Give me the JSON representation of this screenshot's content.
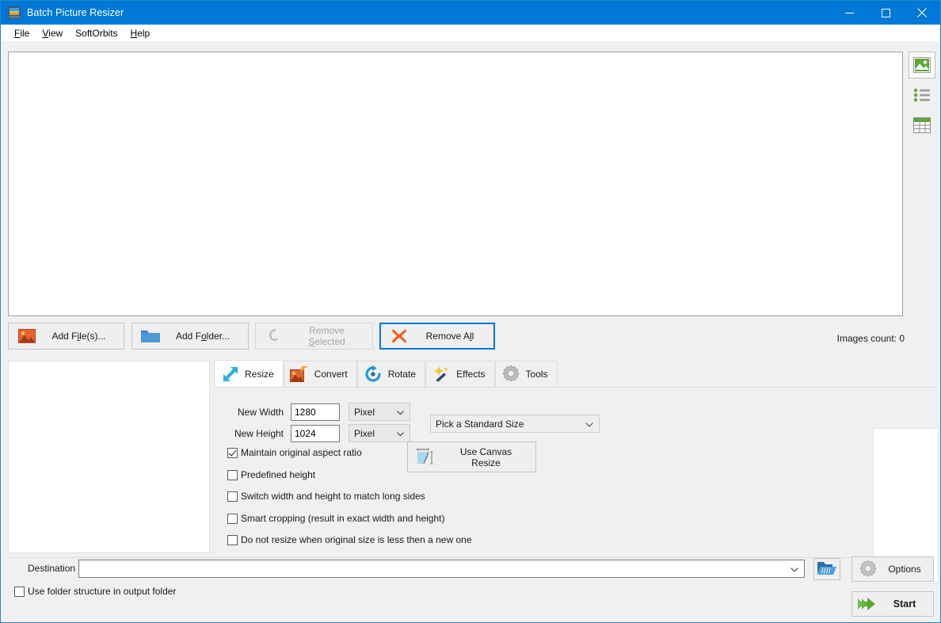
{
  "window": {
    "title": "Batch Picture Resizer",
    "icon": "app-picture-icon",
    "minimize": "minimize-icon",
    "maximize": "maximize-icon",
    "close": "close-icon"
  },
  "menubar": {
    "items": [
      {
        "label": "File",
        "accel": "F"
      },
      {
        "label": "View",
        "accel": "V"
      },
      {
        "label": "SoftOrbits",
        "accel": ""
      },
      {
        "label": "Help",
        "accel": "H"
      }
    ]
  },
  "viewmodes": [
    {
      "name": "thumbnails-view",
      "selected": true
    },
    {
      "name": "list-view",
      "selected": false
    },
    {
      "name": "details-view",
      "selected": false
    }
  ],
  "toolbar": {
    "add_files": "Add File(s)...",
    "add_folder": "Add Folder...",
    "remove_selected": "Remove Selected",
    "remove_all": "Remove All",
    "images_count": "Images count: 0"
  },
  "tabs": [
    {
      "label": "Resize",
      "icon": "resize-arrow-icon",
      "active": true
    },
    {
      "label": "Convert",
      "icon": "convert-image-icon",
      "active": false
    },
    {
      "label": "Rotate",
      "icon": "rotate-icon",
      "active": false
    },
    {
      "label": "Effects",
      "icon": "magic-wand-icon",
      "active": false
    },
    {
      "label": "Tools",
      "icon": "gear-icon",
      "active": false
    }
  ],
  "resize": {
    "width_label": "New Width",
    "width_value": "1280",
    "width_unit": "Pixel",
    "height_label": "New Height",
    "height_value": "1024",
    "height_unit": "Pixel",
    "standard_size": "Pick a Standard Size",
    "canvas_button": "Use Canvas Resize",
    "checkboxes": [
      {
        "label": "Maintain original aspect ratio",
        "checked": true
      },
      {
        "label": "Predefined height",
        "checked": false
      },
      {
        "label": "Switch width and height to match long sides",
        "checked": false
      },
      {
        "label": "Smart cropping (result in exact width and height)",
        "checked": false
      },
      {
        "label": "Do not resize when original size is less then a new one",
        "checked": false
      }
    ]
  },
  "bottom": {
    "destination_label": "Destination",
    "destination_value": "",
    "browse_icon": "open-folder-icon",
    "use_folder_structure": "Use folder structure in output folder",
    "use_folder_structure_checked": false,
    "options_label": "Options",
    "start_label": "Start"
  },
  "colors": {
    "accent": "#0078d7",
    "window_border": "#1e8bc9",
    "face": "#f0f0f0",
    "green": "#5aa832",
    "cyan": "#29b4d8",
    "orange": "#e8642e"
  }
}
